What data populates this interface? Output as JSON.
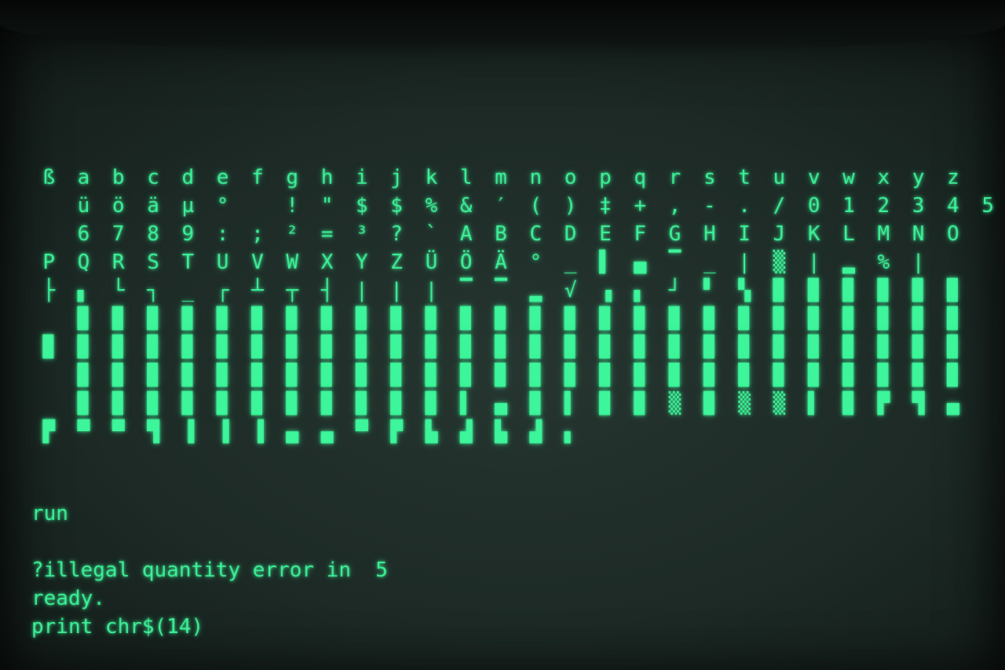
{
  "screen": {
    "phosphor_color": "#3df59a",
    "background_color": "#1d2a26"
  },
  "glyph_rows": [
    [
      "ß",
      "a",
      "b",
      "c",
      "d",
      "e",
      "f",
      "g",
      "h",
      "i",
      "j",
      "k",
      "l",
      "m",
      "n",
      "o",
      "p",
      "q",
      "r",
      "s",
      "t",
      "u",
      "v",
      "w",
      "x",
      "y",
      "z"
    ],
    [
      " ",
      "ü",
      "ö",
      "ä",
      "µ",
      "°",
      " ",
      "!",
      "\"",
      "$",
      "$",
      "%",
      "&",
      "′",
      "(",
      ")",
      "‡",
      "+",
      ",",
      "-",
      ".",
      "/",
      "0",
      "1",
      "2",
      "3",
      "4",
      "5"
    ],
    [
      " ",
      "6",
      "7",
      "8",
      "9",
      ":",
      ";",
      "²",
      "=",
      "³",
      "?",
      "`",
      "A",
      "B",
      "C",
      "D",
      "E",
      "F",
      "G",
      "H",
      "I",
      "J",
      "K",
      "L",
      "M",
      "N",
      "O"
    ],
    [
      "P",
      "Q",
      "R",
      "S",
      "T",
      "U",
      "V",
      "W",
      "X",
      "Y",
      "Z",
      "Ü",
      "Ö",
      "Ä",
      "°",
      "_",
      "▌",
      "▄",
      "▔",
      "_",
      "|",
      "▒",
      "|",
      "▂",
      "%",
      "|"
    ],
    [
      "├",
      "▖",
      "└",
      "┐",
      "_",
      "┌",
      "┴",
      "┬",
      "┤",
      "|",
      "|",
      "|",
      "▔",
      "▔",
      "▂",
      "√",
      "▗",
      "▖",
      "┘",
      "▘",
      "▚",
      "▉",
      "▉",
      "▉",
      "▉",
      "▉",
      "▉"
    ],
    [
      " ",
      "▉",
      "▉",
      "▉",
      "▉",
      "▉",
      "▉",
      "▉",
      "▉",
      "▉",
      "▉",
      "▉",
      "▉",
      "▉",
      "▉",
      "▉",
      "▉",
      "▉",
      "▉",
      "▉",
      "▉",
      "▉",
      "▉",
      "▉",
      "▉",
      "▉",
      "▉"
    ],
    [
      "▉",
      "▉",
      "▉",
      "▉",
      "▉",
      "▉",
      "▉",
      "▉",
      "▉",
      "▉",
      "▉",
      "▉",
      "▉",
      "▉",
      "▉",
      "▉",
      "▉",
      "▉",
      "▉",
      "▉",
      "▉",
      "▉",
      "▉",
      "▉",
      "▉",
      "▉",
      "▉"
    ],
    [
      " ",
      "▉",
      "▉",
      "▉",
      "▉",
      "▉",
      "▉",
      "▉",
      "▉",
      "▉",
      "▉",
      "▉",
      "▉",
      "▉",
      "▉",
      "▉",
      "▉",
      "▉",
      "▉",
      "▉",
      "▉",
      "▉",
      "▉",
      "▉",
      "▉",
      "▉",
      "▉"
    ],
    [
      " ",
      "▉",
      "▉",
      "▉",
      "▉",
      "▉",
      "▉",
      "▉",
      "▉",
      "▉",
      "▉",
      "▉",
      "▌",
      "▄",
      "▉",
      "▌",
      "▉",
      "▉",
      "▒",
      "▉",
      "▒",
      "▒",
      "▌",
      "▉",
      "▛",
      "▜",
      "▄"
    ],
    [
      "▛",
      "▀",
      "▀",
      "▜",
      "▐",
      "▐",
      "▐",
      "▄",
      "▄",
      "▀",
      "▛",
      "▙",
      "▟",
      "▙",
      "▟",
      "▖"
    ]
  ],
  "terminal": {
    "lines": [
      "run",
      "",
      "?illegal quantity error in  5",
      "ready.",
      "print chr$(14)"
    ]
  }
}
